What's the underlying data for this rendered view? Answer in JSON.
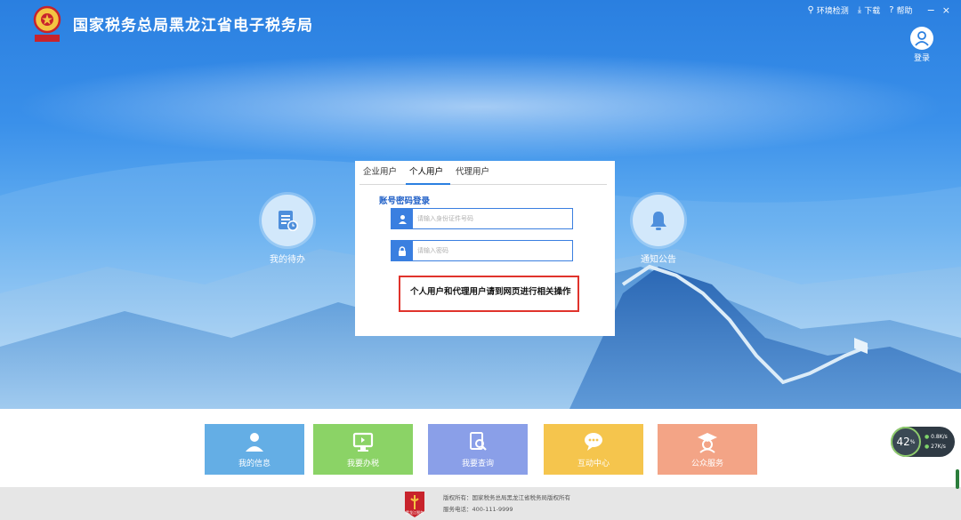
{
  "header": {
    "site_title": "国家税务总局黑龙江省电子税务局",
    "links": [
      {
        "label": "环境检测",
        "icon": "wrench-icon"
      },
      {
        "label": "下载",
        "icon": "download-icon"
      },
      {
        "label": "帮助",
        "icon": "help-icon"
      }
    ],
    "window_controls": [
      "−",
      "×"
    ],
    "login_label": "登录"
  },
  "side": {
    "todo_label": "我的待办",
    "notice_label": "通知公告"
  },
  "login_panel": {
    "tabs": [
      {
        "label": "企业用户",
        "active": false
      },
      {
        "label": "个人用户",
        "active": true
      },
      {
        "label": "代理用户",
        "active": false
      }
    ],
    "heading": "账号密码登录",
    "account_placeholder": "请输入身份证件号码",
    "password_placeholder": "请输入密码",
    "notice_text": "个人用户和代理用户请到网页进行相关操作"
  },
  "services": [
    {
      "label": "我的信息",
      "icon": "person-icon",
      "color": "#64aee5"
    },
    {
      "label": "我要办税",
      "icon": "monitor-icon",
      "color": "#8bd366"
    },
    {
      "label": "我要查询",
      "icon": "search-doc-icon",
      "color": "#8a9fe8"
    },
    {
      "label": "互动中心",
      "icon": "chat-icon",
      "color": "#f5c54d"
    },
    {
      "label": "公众服务",
      "icon": "graduate-icon",
      "color": "#f3a486"
    }
  ],
  "footer": {
    "line1": "版权所有：国家税务总局黑龙江省税务局版权所有",
    "line2": "服务电话：400-111-9999",
    "logo_text": "黑龙江税务"
  },
  "speed_widget": {
    "percent": "42",
    "percent_unit": "%",
    "upload": "0.8K/s",
    "download": "27K/s"
  }
}
